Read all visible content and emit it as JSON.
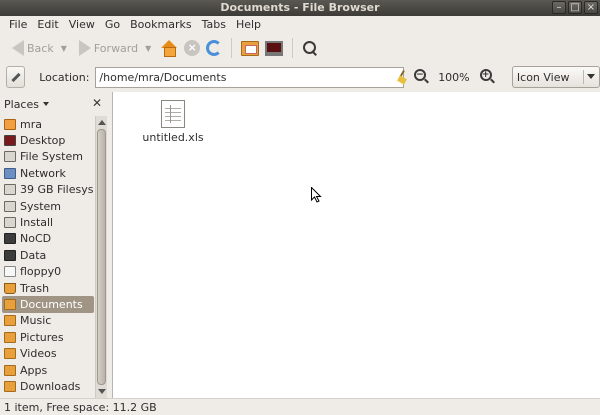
{
  "window": {
    "title": "Documents - File Browser",
    "buttons": {
      "minimize": "–",
      "maximize": "□",
      "close": "×"
    }
  },
  "menubar": {
    "items": [
      "File",
      "Edit",
      "View",
      "Go",
      "Bookmarks",
      "Tabs",
      "Help"
    ]
  },
  "toolbar": {
    "back_label": "Back",
    "forward_label": "Forward"
  },
  "location": {
    "label": "Location:",
    "path": "/home/mra/Documents",
    "zoom": "100%",
    "view_mode": "Icon View"
  },
  "sidebar": {
    "header": "Places",
    "items": [
      {
        "label": "mra",
        "icon": "home"
      },
      {
        "label": "Desktop",
        "icon": "desk"
      },
      {
        "label": "File System",
        "icon": "drive"
      },
      {
        "label": "Network",
        "icon": "net"
      },
      {
        "label": "39 GB Filesys…",
        "icon": "drive"
      },
      {
        "label": "System",
        "icon": "drive"
      },
      {
        "label": "Install",
        "icon": "drive"
      },
      {
        "label": "NoCD",
        "icon": "dark"
      },
      {
        "label": "Data",
        "icon": "dark"
      },
      {
        "label": "floppy0",
        "icon": "floppy"
      },
      {
        "label": "Trash",
        "icon": "trash"
      },
      {
        "label": "Documents",
        "icon": "folder",
        "active": true
      },
      {
        "label": "Music",
        "icon": "folder"
      },
      {
        "label": "Pictures",
        "icon": "folder"
      },
      {
        "label": "Videos",
        "icon": "folder"
      },
      {
        "label": "Apps",
        "icon": "folder"
      },
      {
        "label": "Downloads",
        "icon": "folder"
      }
    ]
  },
  "main": {
    "files": [
      {
        "name": "untitled.xls",
        "icon": "spreadsheet-icon"
      }
    ]
  },
  "status": {
    "text": "1 item, Free space: 11.2 GB"
  }
}
